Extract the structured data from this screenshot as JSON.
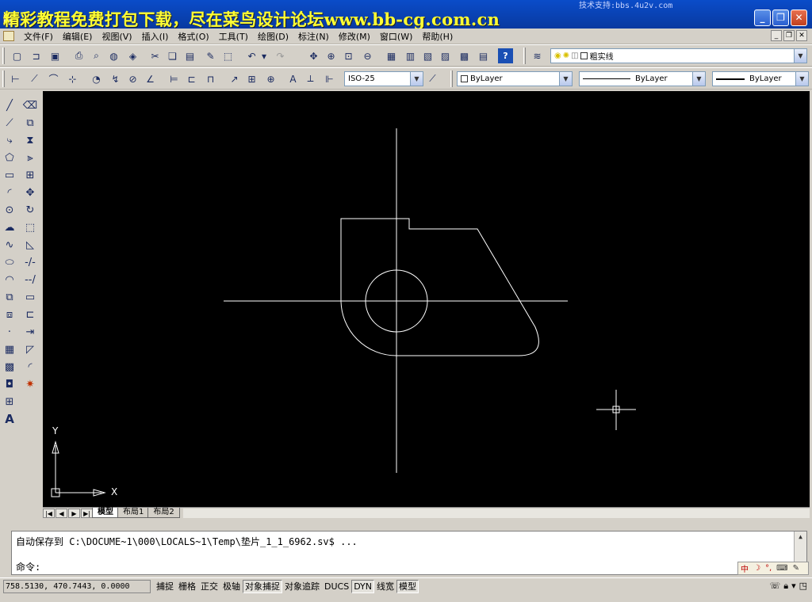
{
  "titlebar": {
    "banner": "精彩教程免费打包下载，尽在菜鸟设计论坛www.bb-cg.com.cn",
    "support": "技术支持:bbs.4u2v.com"
  },
  "menu": {
    "items": [
      "文件(F)",
      "编辑(E)",
      "视图(V)",
      "插入(I)",
      "格式(O)",
      "工具(T)",
      "绘图(D)",
      "标注(N)",
      "修改(M)",
      "窗口(W)",
      "帮助(H)"
    ]
  },
  "toolbar1": {
    "layer_value": "粗实线"
  },
  "toolbar2": {
    "dimstyle_value": "ISO-25",
    "color_value": "ByLayer",
    "linetype_value": "ByLayer",
    "lineweight_value": "ByLayer"
  },
  "canvas": {
    "ucs_x_label": "X",
    "ucs_y_label": "Y"
  },
  "tabs": {
    "items": [
      "模型",
      "布局1",
      "布局2"
    ],
    "active": "模型"
  },
  "command": {
    "history_line": "自动保存到 C:\\DOCUME~1\\000\\LOCALS~1\\Temp\\垫片_1_1_6962.sv$ ...",
    "prompt": "命令:"
  },
  "status": {
    "coordinates": "758.5130, 470.7443, 0.0000",
    "toggles": [
      {
        "label": "捕捉",
        "on": false
      },
      {
        "label": "栅格",
        "on": false
      },
      {
        "label": "正交",
        "on": false
      },
      {
        "label": "极轴",
        "on": false
      },
      {
        "label": "对象捕捉",
        "on": true
      },
      {
        "label": "对象追踪",
        "on": false
      },
      {
        "label": "DUCS",
        "on": false
      },
      {
        "label": "DYN",
        "on": true
      },
      {
        "label": "线宽",
        "on": false
      },
      {
        "label": "模型",
        "on": true
      }
    ]
  },
  "colors": {
    "title_bar": "#0a4cc9",
    "banner_text": "#ffff33",
    "canvas_bg": "#000000",
    "drawing_lines": "#ffffff"
  }
}
